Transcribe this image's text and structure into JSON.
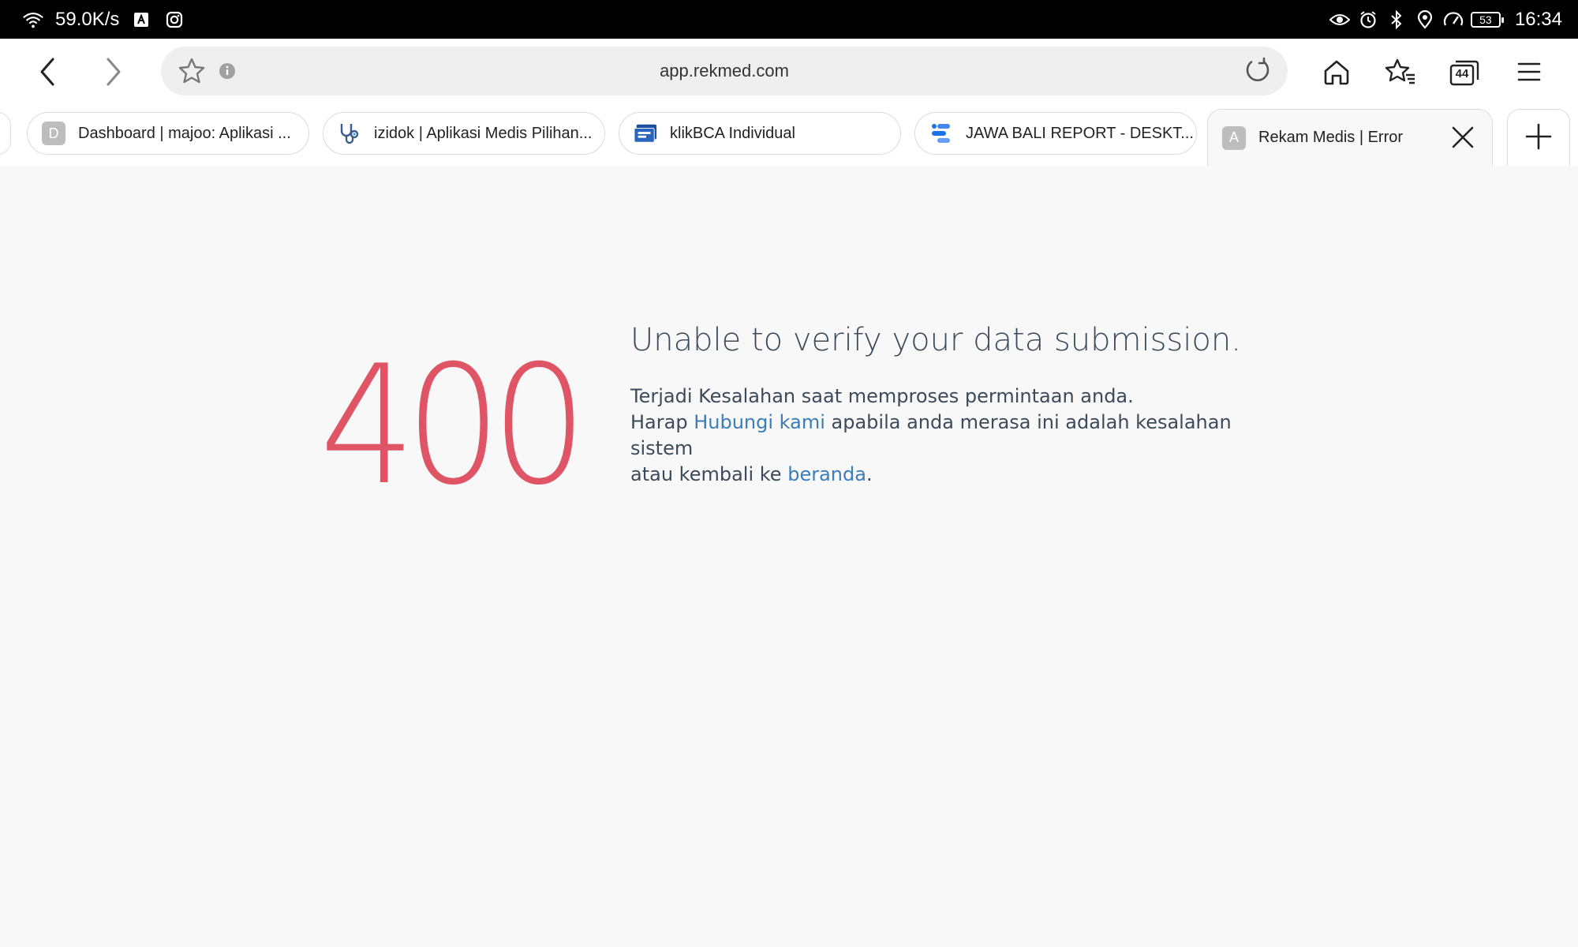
{
  "status_bar": {
    "net_speed": "59.0K/s",
    "battery": "53",
    "time": "16:34",
    "left_icons": [
      "wifi-icon",
      "translate-icon",
      "instagram-icon"
    ],
    "right_icons": [
      "eye-icon",
      "alarm-icon",
      "bluetooth-icon",
      "location-icon",
      "speed-icon"
    ]
  },
  "toolbar": {
    "url": "app.rekmed.com",
    "tab_count": "44"
  },
  "tabs": [
    {
      "label": "Dashboard | majoo: Aplikasi ...",
      "icon_letter": "D"
    },
    {
      "label": "izidok | Aplikasi Medis Pilihan...",
      "icon": "stethoscope-icon"
    },
    {
      "label": "klikBCA Individual",
      "icon": "bca-icon"
    },
    {
      "label": "JAWA BALI REPORT - DESKT...",
      "icon": "lookerstudio-icon"
    },
    {
      "label": "Rekam Medis | Error",
      "icon_letter": "A",
      "active": true
    }
  ],
  "error": {
    "code": "400",
    "title": "Unable to verify your data submission.",
    "line1": "Terjadi Kesalahan saat memproses permintaan anda.",
    "line2_prefix": "Harap ",
    "contact_link": "Hubungi kami",
    "line2_suffix": " apabila anda merasa ini adalah kesalahan sistem",
    "line3_prefix": "atau kembali ke ",
    "home_link": "beranda",
    "line3_suffix": "."
  },
  "colors": {
    "error_code": "#e05565",
    "link": "#3a7dba",
    "text": "#3d4a5a"
  }
}
